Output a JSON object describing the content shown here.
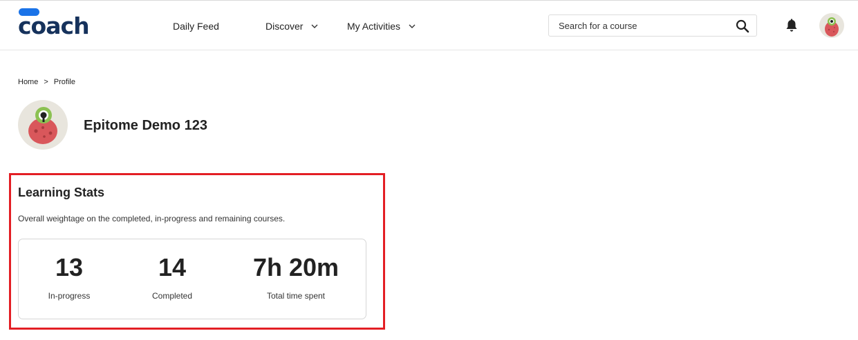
{
  "header": {
    "logo_text": "coach",
    "nav": {
      "daily_feed": "Daily Feed",
      "discover": "Discover",
      "my_activities": "My Activities"
    },
    "search": {
      "placeholder": "Search for a course",
      "value": ""
    },
    "icons": {
      "search": "search-icon",
      "bell": "bell-icon",
      "chevron": "chevron-down-icon",
      "avatar": "monster-avatar"
    },
    "brand_color": "#16325c",
    "accent_color": "#1a73e8"
  },
  "breadcrumb": {
    "home": "Home",
    "separator": ">",
    "current": "Profile"
  },
  "profile": {
    "name": "Epitome Demo 123"
  },
  "learning_stats": {
    "title": "Learning Stats",
    "description": "Overall weightage on the completed, in-progress and remaining courses.",
    "highlight_color": "#e31e24",
    "stats": [
      {
        "value": "13",
        "label": "In-progress"
      },
      {
        "value": "14",
        "label": "Completed"
      },
      {
        "value": "7h 20m",
        "label": "Total time spent"
      }
    ]
  }
}
